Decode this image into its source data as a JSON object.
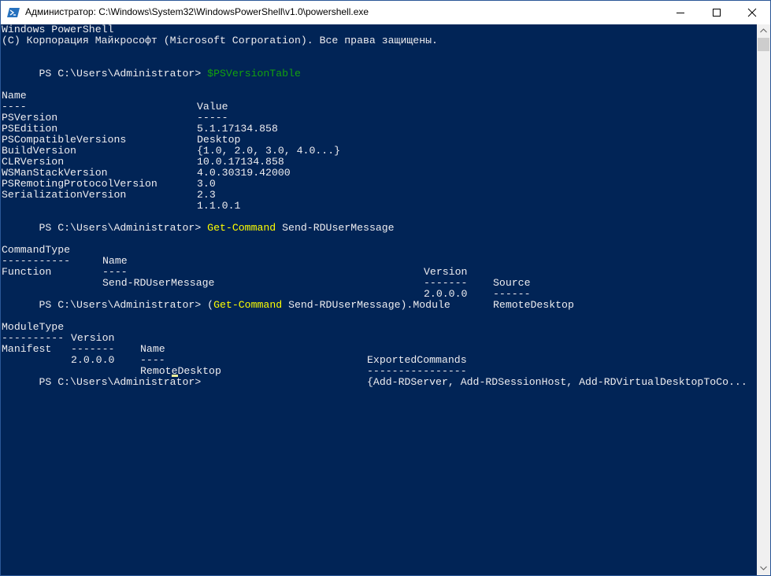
{
  "window": {
    "title": "Администратор: C:\\Windows\\System32\\WindowsPowerShell\\v1.0\\powershell.exe",
    "buttons": {
      "minimize": "minimize-icon",
      "maximize": "maximize-icon",
      "close": "close-icon"
    }
  },
  "colors": {
    "console_background": "#012456",
    "console_text": "#eeedf0",
    "command_text": "#ffff00",
    "variable_text": "#13a10e",
    "titlebar_background": "#ffffff"
  },
  "console": {
    "banner": [
      "Windows PowerShell",
      "(C) Корпорация Майкрософт (Microsoft Corporation). Все права защищены."
    ],
    "prompt": "PS C:\\Users\\Administrator> ",
    "command1": "$PSVersionTable",
    "version_table": {
      "headers": [
        "Name",
        "Value"
      ],
      "underlines": [
        "----",
        "-----"
      ],
      "rows": [
        {
          "name": "PSVersion",
          "value": "5.1.17134.858"
        },
        {
          "name": "PSEdition",
          "value": "Desktop"
        },
        {
          "name": "PSCompatibleVersions",
          "value": "{1.0, 2.0, 3.0, 4.0...}"
        },
        {
          "name": "BuildVersion",
          "value": "10.0.17134.858"
        },
        {
          "name": "CLRVersion",
          "value": "4.0.30319.42000"
        },
        {
          "name": "WSManStackVersion",
          "value": "3.0"
        },
        {
          "name": "PSRemotingProtocolVersion",
          "value": "2.3"
        },
        {
          "name": "SerializationVersion",
          "value": "1.1.0.1"
        }
      ]
    },
    "command2": {
      "cmdlet": "Get-Command",
      "argument": " Send-RDUserMessage"
    },
    "command_table": {
      "headers": [
        "CommandType",
        "Name",
        "Version",
        "Source"
      ],
      "underlines": [
        "-----------",
        "----",
        "-------",
        "------"
      ],
      "rows": [
        {
          "command_type": "Function",
          "name": "Send-RDUserMessage",
          "version": "2.0.0.0",
          "source": "RemoteDesktop"
        }
      ]
    },
    "command3": {
      "open_paren": "(",
      "cmdlet": "Get-Command",
      "rest": " Send-RDUserMessage).Module"
    },
    "module_table": {
      "headers": [
        "ModuleType",
        "Version",
        "Name",
        "ExportedCommands"
      ],
      "underlines": [
        "----------",
        "-------",
        "----",
        "----------------"
      ],
      "rows": [
        {
          "module_type": "Manifest",
          "version": "2.0.0.0",
          "name": "RemoteDesktop",
          "exported_commands": "{Add-RDServer, Add-RDSessionHost, Add-RDVirtualDesktopToCo..."
        }
      ]
    }
  }
}
